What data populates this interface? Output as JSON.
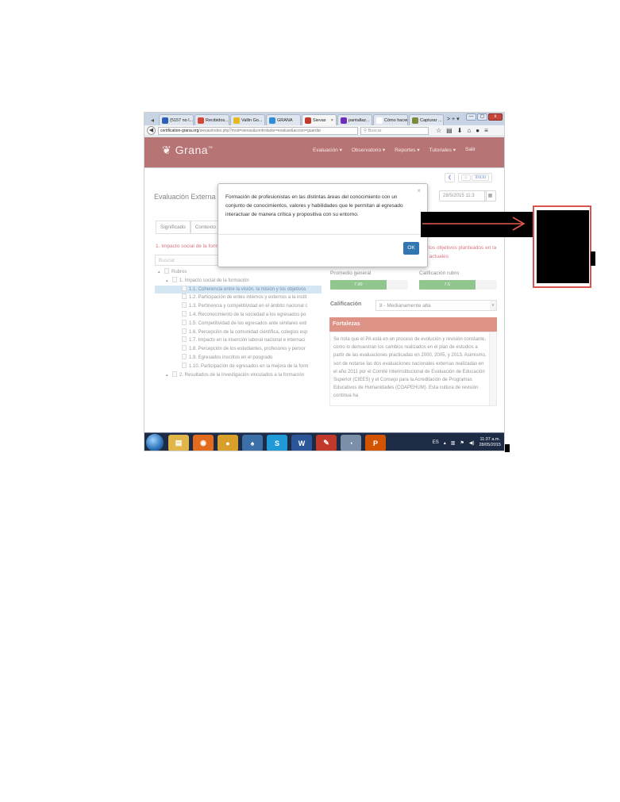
{
  "browser": {
    "tabs": [
      {
        "label": "(5157 no l...",
        "color": "#2a5fb4"
      },
      {
        "label": "Recibidos...",
        "color": "#d44638"
      },
      {
        "label": "Vallin Go...",
        "color": "#e8b822"
      },
      {
        "label": "GRANA",
        "color": "#2a8fd6"
      },
      {
        "label": "Sievas",
        "color": "#c0392b",
        "active": true
      },
      {
        "label": "pantallaz...",
        "color": "#6f2dbd"
      },
      {
        "label": "Cómo hacer ...",
        "color": "#ffffff"
      },
      {
        "label": "Capturar ...",
        "color": "#7a8b3a"
      }
    ],
    "tab_more": "> + ▾",
    "url_host": "certification-grana.org",
    "url_path": "/sievas/index.php?mod=sievas&controlador=evaluar&accion=guardar",
    "search_placeholder": "Buscar",
    "window_buttons": [
      "—",
      "▢",
      "x"
    ]
  },
  "app": {
    "logo": "Grana",
    "logo_tm": "™",
    "nav": [
      "Evaluación ▾",
      "Observatorio ▾",
      "Reportes ▾",
      "Tutoriales ▾",
      "Salir"
    ],
    "home_label": "Inicio",
    "page_title": "Evaluación Externa :: ",
    "date": "28/5/2015 11:3",
    "subtabs": [
      "Significado",
      "Contexto"
    ],
    "left_heading": "1. Impacto social de la formación",
    "left_search_placeholder": "Buscar",
    "tree": [
      {
        "text": "Rubros",
        "level": 0,
        "toggle": "▴"
      },
      {
        "text": "1. Impacto social de la formación",
        "level": 1,
        "toggle": "▴"
      },
      {
        "text": "1.1. Coherencia entre la visión, la misión y los objetivos",
        "level": 2,
        "selected": true
      },
      {
        "text": "1.2. Participación de entes internos y externos a la instit",
        "level": 2
      },
      {
        "text": "1.3. Pertinencia y competitividad en el ámbito nacional c",
        "level": 2
      },
      {
        "text": "1.4. Reconocimiento de la sociedad a los egresados po",
        "level": 2
      },
      {
        "text": "1.5. Competitividad de los egresados ante similares exti",
        "level": 2
      },
      {
        "text": "1.6. Percepción de la comunidad científica, colegios esp",
        "level": 2
      },
      {
        "text": "1.7. Impacto en la inserción laboral nacional e internaci",
        "level": 2
      },
      {
        "text": "1.8. Percepción de los estudiantes, profesores y persor",
        "level": 2
      },
      {
        "text": "1.9. Egresados inscritos en el posgrado",
        "level": 2
      },
      {
        "text": "1.10. Participación de egresados en la mejora de la form",
        "level": 2
      },
      {
        "text": "2. Resultados de la investigación vinculados a la formación",
        "level": 1,
        "toggle": "▴"
      }
    ],
    "right_heading": "1.1. Coherencia entre la visión, la misión y los objetivos planteados en la génesis de la formación con los resultados actuales",
    "promedio_label": "Promedio general",
    "promedio_value": "7.90",
    "promedio_fraction": 0.72,
    "calif_rubro_label": "Calificación rubro",
    "calif_rubro_value": "7.5",
    "calif_rubro_fraction": 0.72,
    "calificacion_label": "Calificación",
    "calificacion_value": "8 - Medianamente alta",
    "fortalezas_label": "Fortalezas",
    "fortalezas_text": "Se nota que el PA está en un proceso de evolución y revisión constante, como lo demuestran los cambios realizados en el plan de estudios a partir de las evaluaciones practicadas en 2000, 2005, y 2013. Asimismo, son de notarse las dos evaluaciones nacionales externas realizadas en el año 2011 por el Comité Interinstitucional de Evaluación de Educación Superior (CIEES) y el Consejo para la Acreditación de Programas Educativos de Humanidades (COAPEHUM). Esta cultura de revisión continua ha"
  },
  "modal": {
    "message": "Formación de profesionistas en las distintas áreas del conocimiento con un conjunto de conocimientos, valores y habilidades que le permitan al egresado interactuar de manera crítica y propositiva con su entorno.",
    "close": "×",
    "ok_label": "OK"
  },
  "taskbar": {
    "apps": [
      {
        "name": "explorer",
        "color": "#e0b64a",
        "glyph": "▤"
      },
      {
        "name": "firefox",
        "color": "#e26b1e",
        "glyph": "◉"
      },
      {
        "name": "chrome",
        "color": "#d8a02a",
        "glyph": "●"
      },
      {
        "name": "notes",
        "color": "#3c6fa8",
        "glyph": "♠"
      },
      {
        "name": "skype",
        "color": "#1f9ad6",
        "glyph": "S"
      },
      {
        "name": "word",
        "color": "#2b579a",
        "glyph": "W"
      },
      {
        "name": "tool",
        "color": "#c0392b",
        "glyph": "✎"
      },
      {
        "name": "media",
        "color": "#7b8fa8",
        "glyph": "◔"
      },
      {
        "name": "paint",
        "color": "#d35400",
        "glyph": "P"
      }
    ],
    "lang": "ES",
    "time": "11:37 a.m.",
    "date": "28/05/2015"
  }
}
